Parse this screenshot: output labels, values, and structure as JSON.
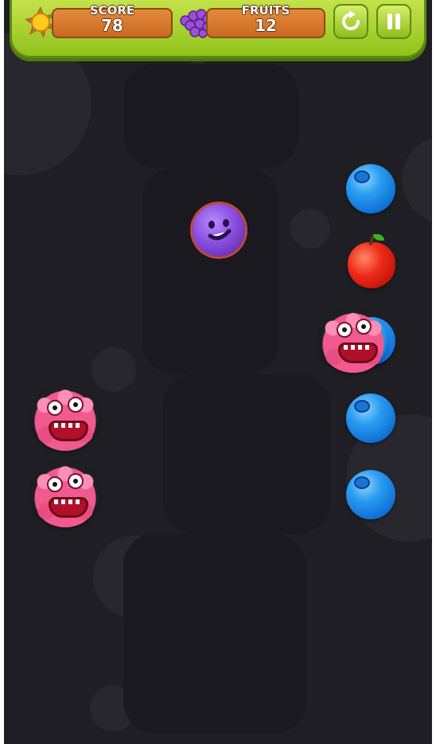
{
  "hud": {
    "score_label": "SCORE",
    "score_value": "78",
    "fruits_label": "FRUITS",
    "fruits_value": "12",
    "restart_icon": "restart-icon",
    "pause_icon": "pause-icon",
    "score_icon": "sun-icon",
    "fruits_icon": "grapes-icon"
  },
  "colors": {
    "background": "#1f1e24",
    "hud_green": "#9ccc2a",
    "panel_orange": "#d8782c"
  },
  "board": {
    "player": "virus",
    "objects": [
      "blueberry",
      "apple",
      "blueberry",
      "raspberry-monster",
      "blueberry",
      "blueberry",
      "raspberry-monster",
      "raspberry-monster"
    ]
  }
}
